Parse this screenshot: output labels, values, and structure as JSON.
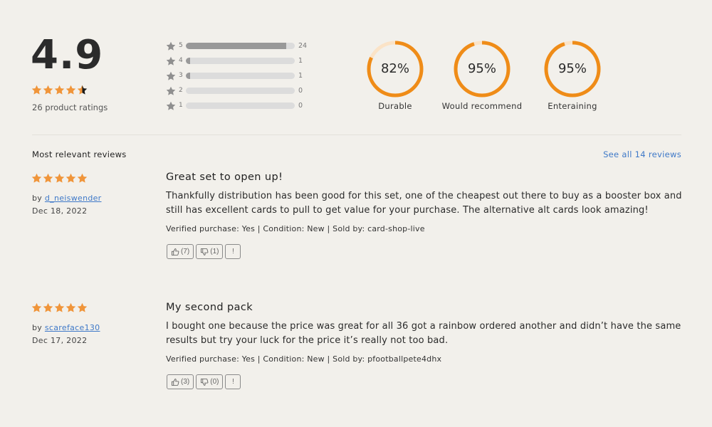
{
  "summary": {
    "average": "4.9",
    "average_stars": 4.9,
    "ratings_count_label": "26 product ratings",
    "star_color": "#f0953a",
    "histogram": [
      {
        "stars": "5",
        "count": "24",
        "fraction": 0.923
      },
      {
        "stars": "4",
        "count": "1",
        "fraction": 0.038
      },
      {
        "stars": "3",
        "count": "1",
        "fraction": 0.038
      },
      {
        "stars": "2",
        "count": "0",
        "fraction": 0
      },
      {
        "stars": "1",
        "count": "0",
        "fraction": 0
      }
    ],
    "attributes": [
      {
        "label": "Durable",
        "value_label": "82%",
        "percent": 82
      },
      {
        "label": "Would recommend",
        "value_label": "95%",
        "percent": 95
      },
      {
        "label": "Enteraining",
        "value_label": "95%",
        "percent": 95
      }
    ],
    "donut_color": "#ef8c18",
    "donut_track_color": "#fbe3c7"
  },
  "reviews_section": {
    "title": "Most relevant reviews",
    "see_all_label": "See all 14 reviews",
    "link_color": "#3f79c8"
  },
  "reviews": [
    {
      "stars": 5,
      "by_prefix": "by",
      "author": "d_neiswender",
      "date": "Dec 18, 2022",
      "title": "Great set to open up!",
      "body": "Thankfully distribution has been good for this set, one of the cheapest out there to buy as a booster box and still has excellent cards to pull to get value for your purchase. The alternative alt cards look amazing!",
      "meta": "Verified purchase: Yes | Condition: New | Sold by: card-shop-live",
      "helpful_label": "(7)",
      "unhelpful_label": "(1)",
      "flag_label": "!"
    },
    {
      "stars": 5,
      "by_prefix": "by",
      "author": "scareface130",
      "date": "Dec 17, 2022",
      "title": "My second pack",
      "body": "I bought one because the price was great for all 36 got a rainbow ordered another and didn’t have the same results but try your luck for the price it’s really not too bad.",
      "meta": "Verified purchase: Yes | Condition: New | Sold by: pfootballpete4dhx",
      "helpful_label": "(3)",
      "unhelpful_label": "(0)",
      "flag_label": "!"
    }
  ]
}
